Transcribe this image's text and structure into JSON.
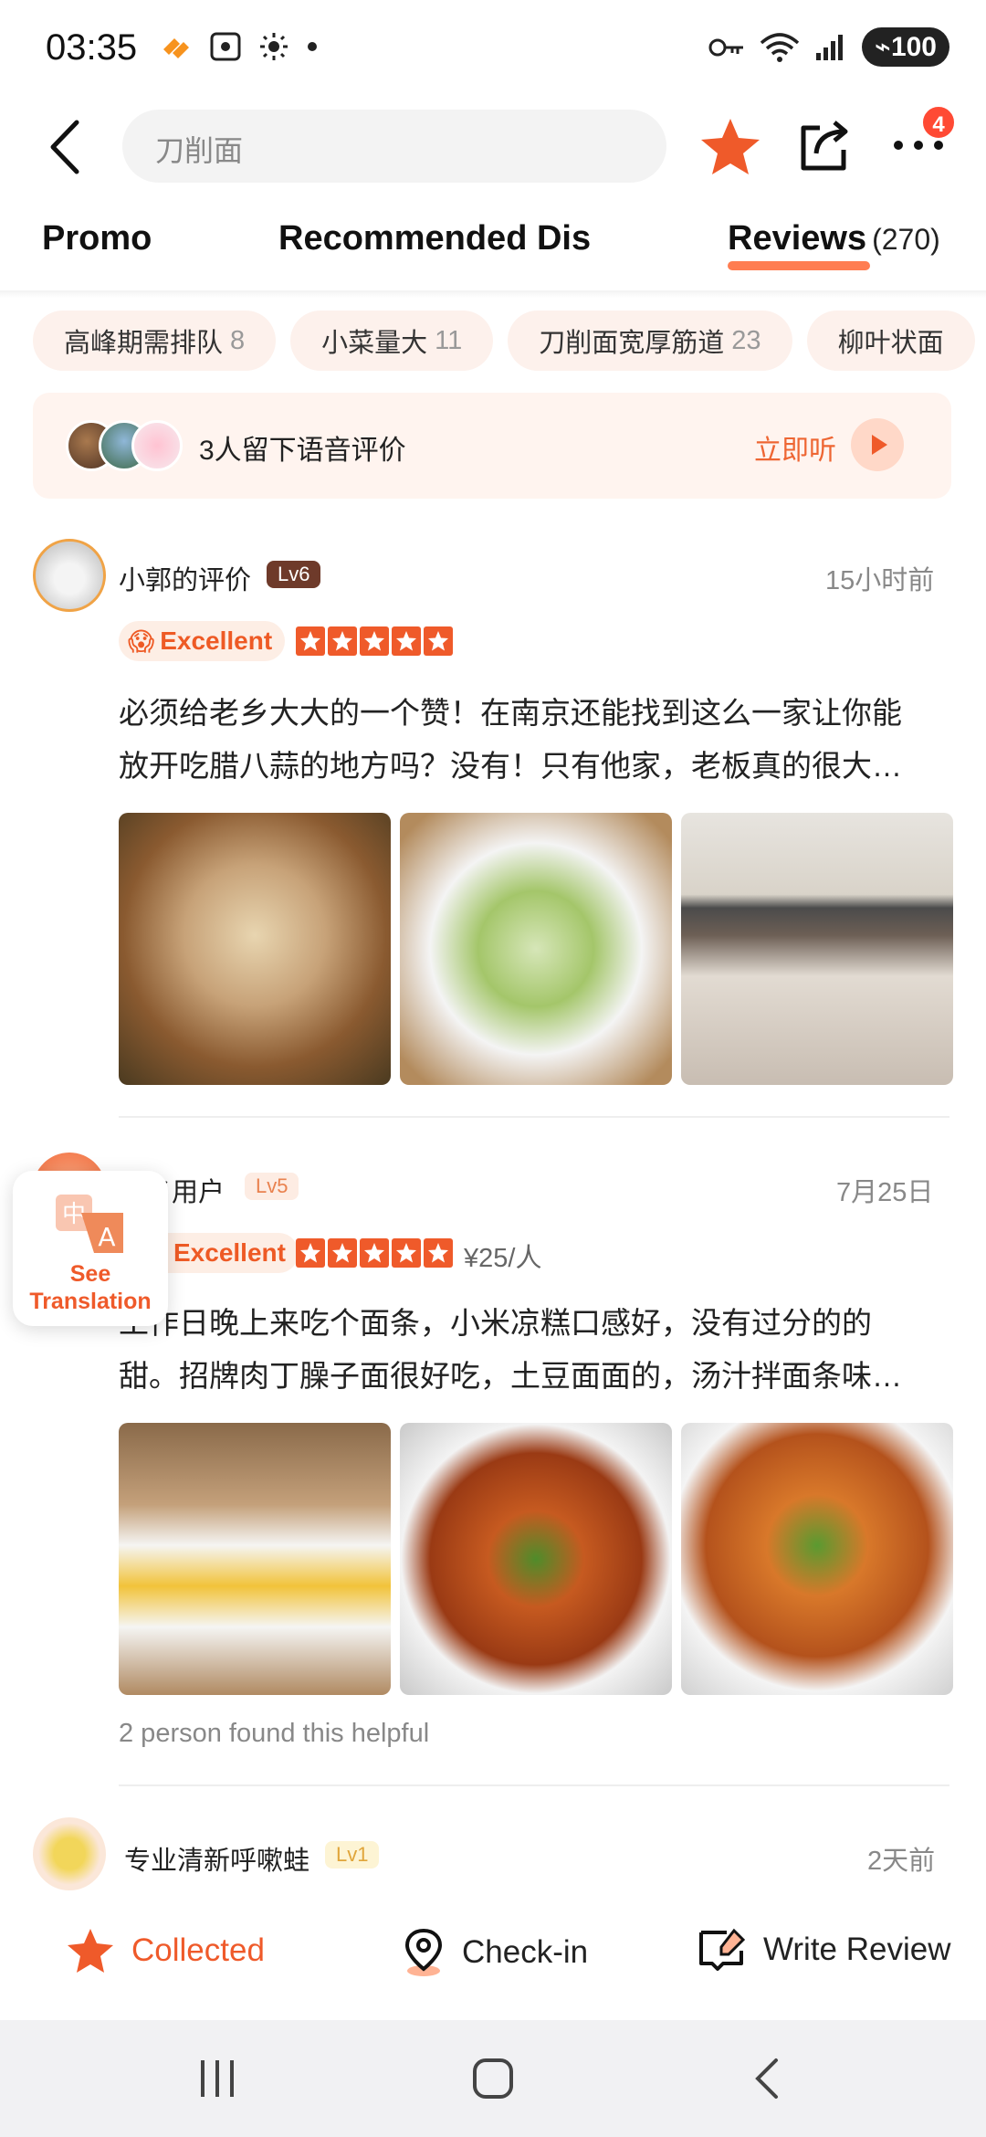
{
  "status_bar": {
    "time": "03:35",
    "battery": "100",
    "icons": [
      "app-notification-icon",
      "screenshot-icon",
      "brightness-icon",
      "dot-icon",
      "key-icon",
      "wifi-icon",
      "signal-icon",
      "battery-icon"
    ]
  },
  "header": {
    "search_text": "刀削面",
    "more_badge": "4",
    "accent_color": "#ef5a2a"
  },
  "tabs": [
    {
      "label": "Promo"
    },
    {
      "label": "Recommended Dis"
    },
    {
      "label": "Reviews",
      "count": "(270)",
      "active": true
    }
  ],
  "chips": [
    {
      "label": "高峰期需排队",
      "count": "8"
    },
    {
      "label": "小菜量大",
      "count": "11"
    },
    {
      "label": "刀削面宽厚筋道",
      "count": "23"
    },
    {
      "label": "柳叶状面",
      "count": ""
    }
  ],
  "voice_banner": {
    "text": "3人留下语音评价",
    "action": "立即听"
  },
  "reviews": [
    {
      "name": "小郭的评价",
      "level": "Lv6",
      "time": "15小时前",
      "rating_label": "Excellent",
      "stars": 5,
      "price": "",
      "body_line1": "必须给老乡大大的一个赞！在南京还能找到这么一家让你能",
      "body_line2": "放开吃腊八蒜的地方吗？没有！只有他家，老板真的很大…",
      "helpful": ""
    },
    {
      "name": "匿名用户",
      "level": "Lv5",
      "time": "7月25日",
      "rating_label": "Excellent",
      "stars": 5,
      "price": "¥25/人",
      "body_line1": "工作日晚上来吃个面条，小米凉糕口感好，没有过分的的",
      "body_line2": "甜。招牌肉丁臊子面很好吃，土豆面面的，汤汁拌面条味…",
      "helpful": "2 person found this helpful"
    },
    {
      "name": "专业清新呼嗽蛙",
      "level": "Lv1",
      "time": "2天前"
    }
  ],
  "translate_card": {
    "label_line1": "See",
    "label_line2": "Translation"
  },
  "action_bar": {
    "collected": "Collected",
    "checkin": "Check-in",
    "write_review": "Write Review"
  }
}
